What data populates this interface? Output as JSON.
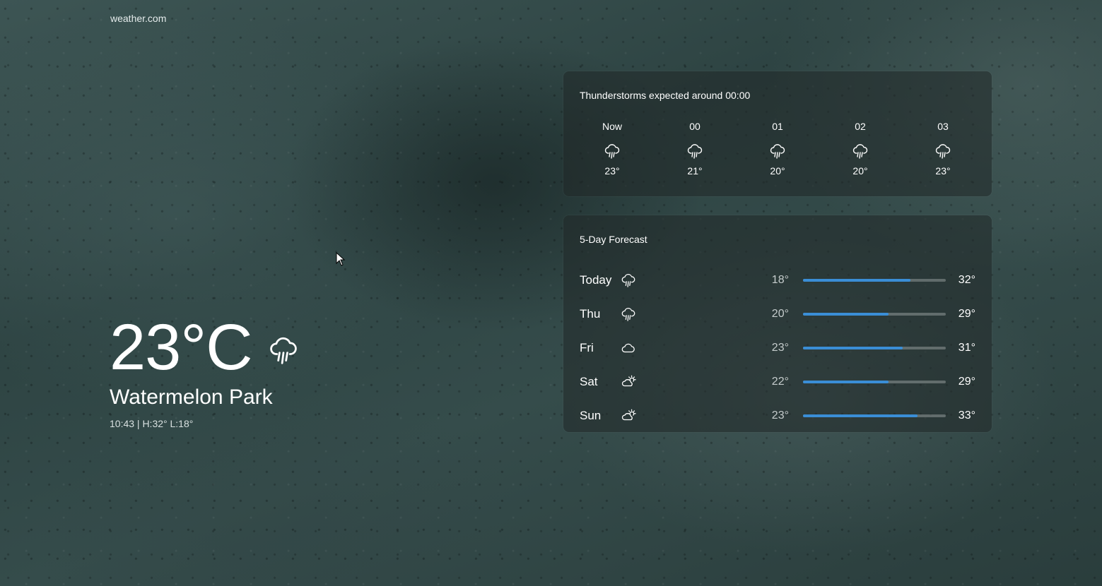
{
  "brand": "weather.com",
  "current": {
    "temperature": "23°C",
    "icon": "rain-cloud-icon",
    "location": "Watermelon Park",
    "meta": "10:43 | H:32° L:18°"
  },
  "hourly": {
    "title": "Thunderstorms expected around 00:00",
    "items": [
      {
        "label": "Now",
        "icon": "rain-cloud-icon",
        "temp": "23°"
      },
      {
        "label": "00",
        "icon": "rain-cloud-icon",
        "temp": "21°"
      },
      {
        "label": "01",
        "icon": "rain-cloud-icon",
        "temp": "20°"
      },
      {
        "label": "02",
        "icon": "rain-cloud-icon",
        "temp": "20°"
      },
      {
        "label": "03",
        "icon": "rain-cloud-icon",
        "temp": "23°"
      }
    ]
  },
  "daily": {
    "title": "5-Day Forecast",
    "items": [
      {
        "day": "Today",
        "icon": "rain-cloud-icon",
        "low": "18°",
        "high": "32°",
        "range_fill": 0.75
      },
      {
        "day": "Thu",
        "icon": "rain-cloud-icon",
        "low": "20°",
        "high": "29°",
        "range_fill": 0.6
      },
      {
        "day": "Fri",
        "icon": "cloud-icon",
        "low": "23°",
        "high": "31°",
        "range_fill": 0.7
      },
      {
        "day": "Sat",
        "icon": "partly-sunny-icon",
        "low": "22°",
        "high": "29°",
        "range_fill": 0.6
      },
      {
        "day": "Sun",
        "icon": "partly-sunny-icon",
        "low": "23°",
        "high": "33°",
        "range_fill": 0.8
      }
    ]
  },
  "colors": {
    "accent": "#3a8ed6",
    "card_bg": "#202828"
  }
}
